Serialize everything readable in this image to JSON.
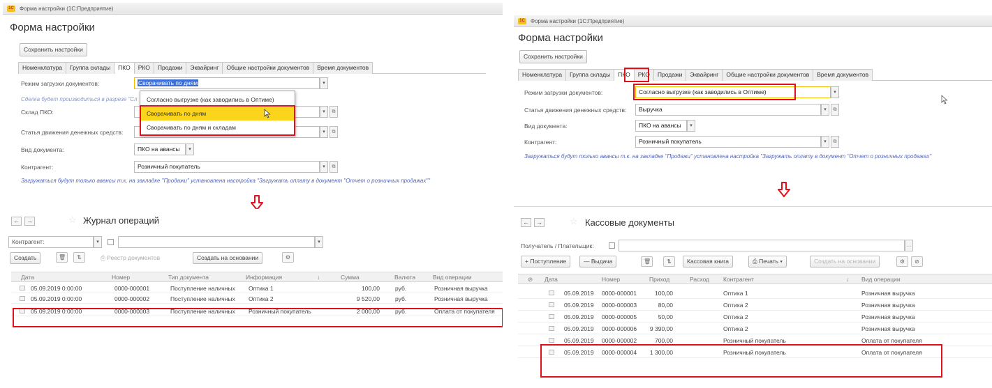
{
  "left_window": {
    "title": "Форма настройки (1С:Предприятие)",
    "form_title": "Форма настройки",
    "save_button": "Сохранить настройки",
    "tabs": [
      "Номенклатура",
      "Группа склады",
      "ПКО",
      "РКО",
      "Продажи",
      "Эквайринг",
      "Общие настройки документов",
      "Время документов"
    ],
    "fields": {
      "load_mode_label": "Режим загрузки документов:",
      "load_mode_value": "Сворачивать по дням",
      "hint": "Сделка будет производиться в разрезе \"Сл",
      "warehouse_label": "Склад ПКО:",
      "cashflow_label": "Статья движения денежных средств:",
      "doctype_label": "Вид документа:",
      "doctype_value": "ПКО на авансы",
      "counterparty_label": "Контрагент:",
      "counterparty_value": "Розничный покупатель"
    },
    "dropdown_options": [
      "Согласно выгрузке (как заводились в Оптиме)",
      "Сворачивать по дням",
      "Сворачивать по дням и складам"
    ],
    "note": "Загружаться будут только авансы т.к. на закладке \"Продажи\" установлена настройка \"Загружать оплату в документ \"Отчет о розничных продажах\"\""
  },
  "left_journal": {
    "title": "Журнал операций",
    "filter_label": "Контрагент:",
    "toolbar": {
      "create": "Создать",
      "registry": "Реестр документов",
      "create_based": "Создать на основании"
    },
    "columns": [
      "Дата",
      "Номер",
      "Тип документа",
      "Информация",
      "Сумма",
      "Валюта",
      "Вид операции"
    ],
    "rows": [
      [
        "05.09.2019 0:00:00",
        "0000-000001",
        "Поступление наличных",
        "Оптика 1",
        "100,00",
        "руб.",
        "Розничная выручка"
      ],
      [
        "05.09.2019 0:00:00",
        "0000-000002",
        "Поступление наличных",
        "Оптика 2",
        "9 520,00",
        "руб.",
        "Розничная выручка"
      ],
      [
        "05.09.2019 0:00:00",
        "0000-000003",
        "Поступление наличных",
        "Розничный покупатель",
        "2 000,00",
        "руб.",
        "Оплата от покупателя"
      ]
    ]
  },
  "right_window": {
    "title": "Форма настройки (1С:Предприятие)",
    "form_title": "Форма настройки",
    "save_button": "Сохранить настройки",
    "tabs": [
      "Номенклатура",
      "Группа склады",
      "ПКО",
      "РКО",
      "Продажи",
      "Эквайринг",
      "Общие настройки документов",
      "Время документов"
    ],
    "fields": {
      "load_mode_label": "Режим загрузки документов:",
      "load_mode_value": "Согласно выгрузке (как заводились в Оптиме)",
      "cashflow_label": "Статья движения денежных средств:",
      "cashflow_value": "Выручка",
      "doctype_label": "Вид документа:",
      "doctype_value": "ПКО на авансы",
      "counterparty_label": "Контрагент:",
      "counterparty_value": "Розничный покупатель"
    },
    "note": "Загружаться будут только авансы т.к. на закладке \"Продажи\" установлена настройка \"Загружать оплату в документ \"Отчет о розничных продажах\""
  },
  "right_journal": {
    "title": "Кассовые документы",
    "filter_label": "Получатель / Плательщик:",
    "toolbar": {
      "receipt": "Поступление",
      "issue": "Выдача",
      "cashbook": "Кассовая книга",
      "print": "Печать",
      "create_based": "Создать на основании"
    },
    "columns": [
      "Дата",
      "Номер",
      "Приход",
      "Расход",
      "Контрагент",
      "Вид операции"
    ],
    "rows": [
      [
        "05.09.2019",
        "0000-000001",
        "100,00",
        "",
        "Оптика 1",
        "Розничная выручка"
      ],
      [
        "05.09.2019",
        "0000-000003",
        "80,00",
        "",
        "Оптика 2",
        "Розничная выручка"
      ],
      [
        "05.09.2019",
        "0000-000005",
        "50,00",
        "",
        "Оптика 2",
        "Розничная выручка"
      ],
      [
        "05.09.2019",
        "0000-000006",
        "9 390,00",
        "",
        "Оптика 2",
        "Розничная выручка"
      ],
      [
        "05.09.2019",
        "0000-000002",
        "700,00",
        "",
        "Розничный покупатель",
        "Оплата от покупателя"
      ],
      [
        "05.09.2019",
        "0000-000004",
        "1 300,00",
        "",
        "Розничный покупатель",
        "Оплата от покупателя"
      ]
    ]
  },
  "colors": {
    "highlight_red": "#e0101a",
    "selected_yellow": "#fbd51c",
    "note_blue": "#5468b8"
  }
}
